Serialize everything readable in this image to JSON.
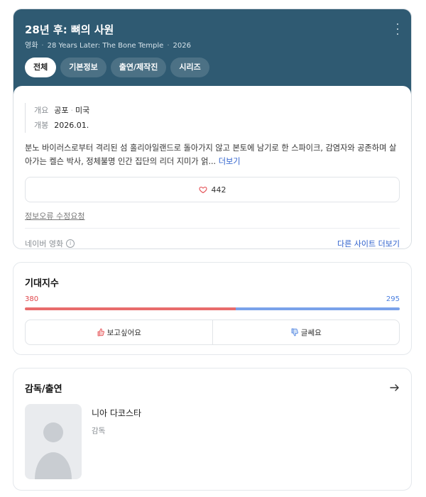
{
  "header": {
    "title": "28년 후: 뼈의 사원",
    "type": "영화",
    "original_title": "28 Years Later: The Bone Temple",
    "year": "2026",
    "more_icon": "more-vertical-icon",
    "tabs": [
      {
        "label": "전체",
        "active": true
      },
      {
        "label": "기본정보",
        "active": false
      },
      {
        "label": "출연/제작진",
        "active": false
      },
      {
        "label": "시리즈",
        "active": false
      }
    ],
    "colors": {
      "hero_bg": "#2f5a72"
    }
  },
  "info": {
    "overview_label": "개요",
    "genre": "공포",
    "country": "미국",
    "release_label": "개봉",
    "release": "2026.01.",
    "synopsis": "분노 바이러스로부터 격리된 섬 홀리아일랜드로 돌아가지 않고 본토에 남기로 한 스파이크, 감염자와 공존하며 살아가는 켈슨 박사, 정체불명 인간 집단의 리더 지미가 얽...",
    "synopsis_more": "더보기",
    "like_count": "442",
    "like_icon": "heart-icon",
    "report_link": "정보오류 수정요청",
    "source": "네이버 영화",
    "source_info_icon": "info-circle-icon",
    "other_sites": "다른 사이트 더보기"
  },
  "expectation": {
    "title": "기대지수",
    "want_count": "380",
    "not_sure_count": "295",
    "want_ratio": 0.563,
    "want_label": "보고싶어요",
    "not_sure_label": "글쎄요",
    "want_icon": "thumbs-up-icon",
    "not_sure_icon": "thumbs-down-icon",
    "colors": {
      "want": "#e86b6b",
      "not_sure": "#7aa2ea"
    }
  },
  "cast": {
    "title": "감독/출연",
    "arrow_icon": "arrow-right-icon",
    "people": [
      {
        "name": "니아 다코스타",
        "role": "감독",
        "avatar_icon": "person-placeholder-icon"
      }
    ]
  }
}
